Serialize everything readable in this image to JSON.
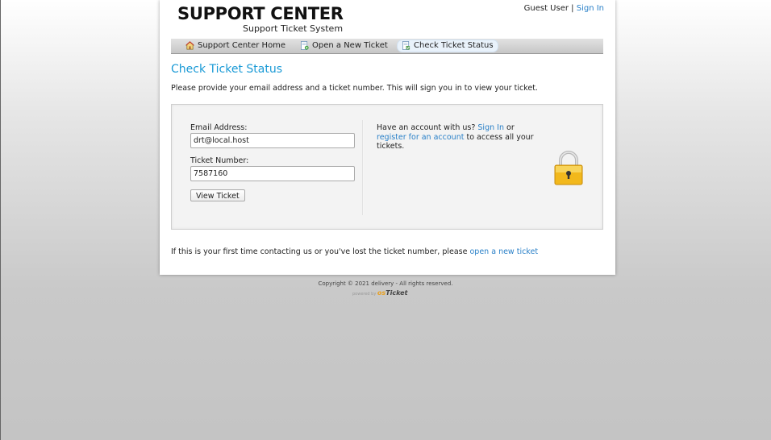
{
  "header": {
    "logo_title": "SUPPORT CENTER",
    "logo_subtitle": "Support Ticket System",
    "user_label": "Guest User",
    "separator": "|",
    "sign_in": "Sign In"
  },
  "nav": {
    "items": [
      {
        "label": "Support Center Home",
        "icon": "home-icon"
      },
      {
        "label": "Open a New Ticket",
        "icon": "new-ticket-icon"
      },
      {
        "label": "Check Ticket Status",
        "icon": "ticket-status-icon",
        "active": true
      }
    ]
  },
  "main": {
    "title": "Check Ticket Status",
    "intro": "Please provide your email address and a ticket number. This will sign you in to view your ticket.",
    "form": {
      "email_label": "Email Address:",
      "email_value": "drt@local.host",
      "ticket_label": "Ticket Number:",
      "ticket_value": "7587160",
      "submit_label": "View Ticket"
    },
    "side": {
      "text_1": "Have an account with us?",
      "sign_in_link": "Sign In",
      "text_2": "or",
      "register_link": "register for an account",
      "text_3": "to access all your tickets."
    },
    "footer_text": "If this is your first time contacting us or you've lost the ticket number, please",
    "footer_link": "open a new ticket"
  },
  "footer": {
    "copyright": "Copyright © 2021 delivery - All rights reserved.",
    "powered_by": "powered by",
    "brand_prefix": "os",
    "brand_name": "Ticket"
  },
  "colors": {
    "accent": "#1a9ad6",
    "link": "#2a80c8",
    "lock_body": "#f2b81c"
  }
}
